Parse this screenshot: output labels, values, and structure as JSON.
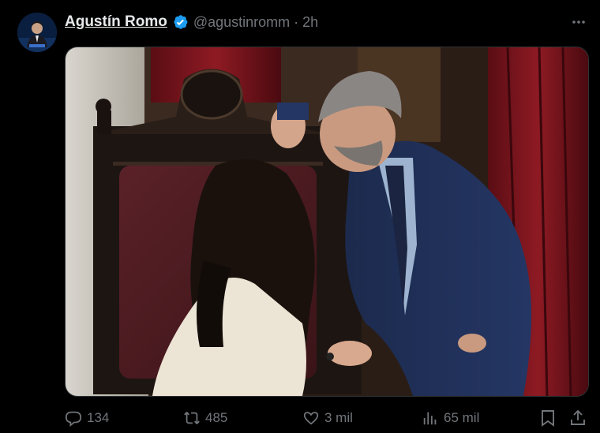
{
  "tweet": {
    "author_name": "Agustín Romo",
    "handle": "@agustinromm",
    "separator": "·",
    "time": "2h",
    "verified": true
  },
  "media": {
    "kind": "photo"
  },
  "actions": {
    "replies": "134",
    "reposts": "485",
    "likes": "3 mil",
    "views": "65 mil"
  },
  "icons": {
    "more": "more-icon",
    "reply": "reply-icon",
    "repost": "repost-icon",
    "like": "like-icon",
    "views": "views-icon",
    "bookmark": "bookmark-icon",
    "share": "share-icon",
    "verified": "verified-badge-icon"
  },
  "colors": {
    "background": "#000000",
    "text_primary": "#e7e9ea",
    "text_secondary": "#71767b",
    "verified_blue": "#1d9bf0"
  }
}
